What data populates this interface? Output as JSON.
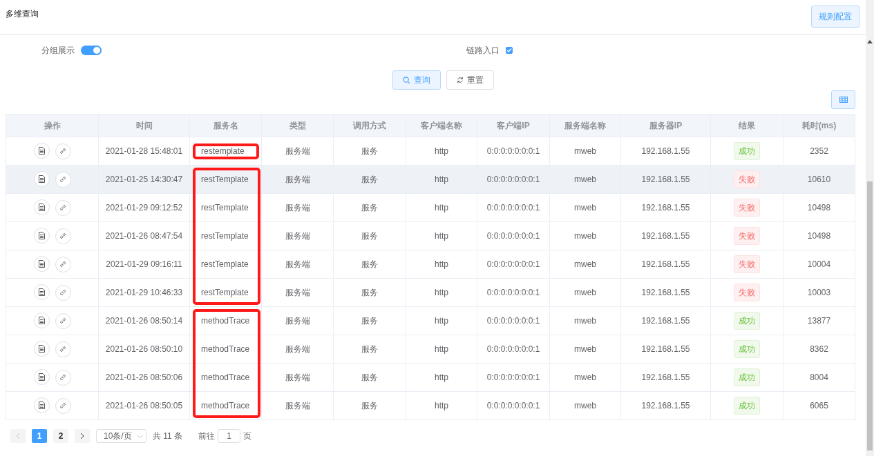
{
  "header": {
    "title": "多维查询",
    "button": "规则配置"
  },
  "filters": [
    {
      "kind": "switch",
      "label": "分组展示",
      "on": true
    },
    {
      "kind": "checkbox",
      "label": "链路入口",
      "checked": true
    }
  ],
  "actions": [
    {
      "kind": "search",
      "label": "查询",
      "primary": true
    },
    {
      "kind": "refresh",
      "label": "重置",
      "primary": false
    }
  ],
  "table": {
    "columns": [
      "操作",
      "时间",
      "服务名",
      "类型",
      "调用方式",
      "客户端名称",
      "客户端IP",
      "服务端名称",
      "服务器IP",
      "结果",
      "耗时(ms)"
    ],
    "row_groups": [
      {
        "outlined": true,
        "rows": [
          {
            "time": "2021-01-28 15:48:01",
            "service": "restemplate",
            "type": "服务端",
            "method": "服务",
            "client": "http",
            "client_ip": "0:0:0:0:0:0:0:1",
            "server": "mweb",
            "server_ip": "192.168.1.55",
            "result": "成功",
            "success": true,
            "duration": "2352",
            "hover": false
          }
        ]
      },
      {
        "outlined": true,
        "rows": [
          {
            "time": "2021-01-25 14:30:47",
            "service": "restTemplate",
            "type": "服务端",
            "method": "服务",
            "client": "http",
            "client_ip": "0:0:0:0:0:0:0:1",
            "server": "mweb",
            "server_ip": "192.168.1.55",
            "result": "失败",
            "success": false,
            "duration": "10610",
            "hover": true
          },
          {
            "time": "2021-01-29 09:12:52",
            "service": "restTemplate",
            "type": "服务端",
            "method": "服务",
            "client": "http",
            "client_ip": "0:0:0:0:0:0:0:1",
            "server": "mweb",
            "server_ip": "192.168.1.55",
            "result": "失败",
            "success": false,
            "duration": "10498",
            "hover": false
          },
          {
            "time": "2021-01-26 08:47:54",
            "service": "restTemplate",
            "type": "服务端",
            "method": "服务",
            "client": "http",
            "client_ip": "0:0:0:0:0:0:0:1",
            "server": "mweb",
            "server_ip": "192.168.1.55",
            "result": "失败",
            "success": false,
            "duration": "10498",
            "hover": false
          },
          {
            "time": "2021-01-29 09:16:11",
            "service": "restTemplate",
            "type": "服务端",
            "method": "服务",
            "client": "http",
            "client_ip": "0:0:0:0:0:0:0:1",
            "server": "mweb",
            "server_ip": "192.168.1.55",
            "result": "失败",
            "success": false,
            "duration": "10004",
            "hover": false
          },
          {
            "time": "2021-01-29 10:46:33",
            "service": "restTemplate",
            "type": "服务端",
            "method": "服务",
            "client": "http",
            "client_ip": "0:0:0:0:0:0:0:1",
            "server": "mweb",
            "server_ip": "192.168.1.55",
            "result": "失败",
            "success": false,
            "duration": "10003",
            "hover": false
          }
        ]
      },
      {
        "outlined": true,
        "rows": [
          {
            "time": "2021-01-26 08:50:14",
            "service": "methodTrace",
            "type": "服务端",
            "method": "服务",
            "client": "http",
            "client_ip": "0:0:0:0:0:0:0:1",
            "server": "mweb",
            "server_ip": "192.168.1.55",
            "result": "成功",
            "success": true,
            "duration": "13877",
            "hover": false
          },
          {
            "time": "2021-01-26 08:50:10",
            "service": "methodTrace",
            "type": "服务端",
            "method": "服务",
            "client": "http",
            "client_ip": "0:0:0:0:0:0:0:1",
            "server": "mweb",
            "server_ip": "192.168.1.55",
            "result": "成功",
            "success": true,
            "duration": "8362",
            "hover": false
          },
          {
            "time": "2021-01-26 08:50:06",
            "service": "methodTrace",
            "type": "服务端",
            "method": "服务",
            "client": "http",
            "client_ip": "0:0:0:0:0:0:0:1",
            "server": "mweb",
            "server_ip": "192.168.1.55",
            "result": "成功",
            "success": true,
            "duration": "8004",
            "hover": false
          },
          {
            "time": "2021-01-26 08:50:05",
            "service": "methodTrace",
            "type": "服务端",
            "method": "服务",
            "client": "http",
            "client_ip": "0:0:0:0:0:0:0:1",
            "server": "mweb",
            "server_ip": "192.168.1.55",
            "result": "成功",
            "success": true,
            "duration": "6065",
            "hover": false
          }
        ]
      }
    ]
  },
  "pagination": {
    "pages": [
      {
        "label": "1",
        "selected": true
      },
      {
        "label": "2",
        "selected": false
      }
    ],
    "prev_disabled": true,
    "page_size": "10条/页",
    "total": "共 11 条",
    "goto_label": "前往",
    "goto_value": "1",
    "goto_suffix": "页"
  }
}
